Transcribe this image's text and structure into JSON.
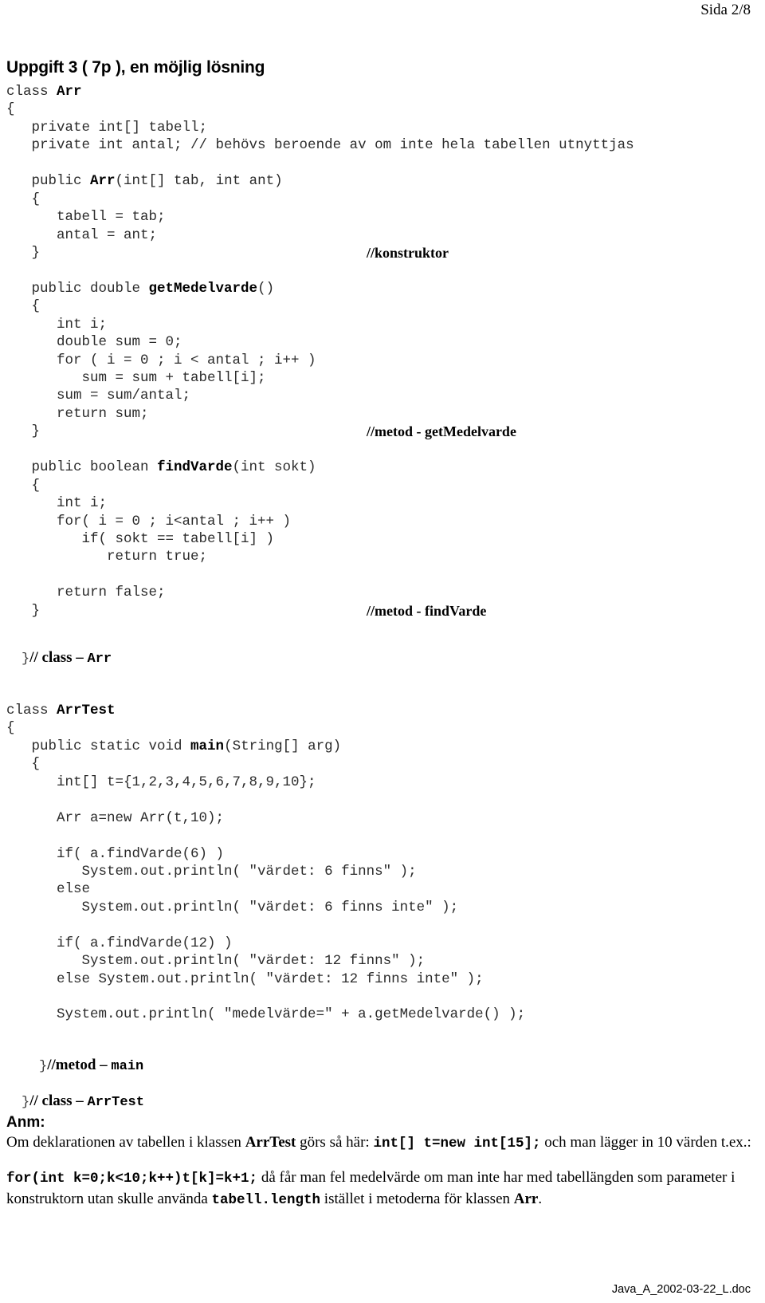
{
  "header": {
    "page_indicator": "Sida 2/8"
  },
  "title": "Uppgift 3 ( 7p ), en möjlig lösning",
  "code": {
    "lines": [
      {
        "text": "class ",
        "bold": "Arr",
        "after": ""
      },
      {
        "text": "{"
      },
      {
        "text": "   private int[] tabell;"
      },
      {
        "text": "   private int antal; // behövs beroende av om inte hela tabellen utnyttjas"
      },
      {
        "text": ""
      },
      {
        "text": "   public ",
        "bold": "Arr",
        "after": "(int[] tab, int ant)"
      },
      {
        "text": "   {"
      },
      {
        "text": "      tabell = tab;"
      },
      {
        "text": "      antal = ant;"
      },
      {
        "text": "   }",
        "annot": "//konstruktor"
      },
      {
        "text": ""
      },
      {
        "text": "   public double ",
        "bold": "getMedelvarde",
        "after": "()"
      },
      {
        "text": "   {"
      },
      {
        "text": "      int i;"
      },
      {
        "text": "      double sum = 0;"
      },
      {
        "text": "      for ( i = 0 ; i < antal ; i++ )"
      },
      {
        "text": "         sum = sum + tabell[i];"
      },
      {
        "text": "      sum = sum/antal;"
      },
      {
        "text": "      return sum;"
      },
      {
        "text": "   }",
        "annot": "//metod - getMedelvarde"
      },
      {
        "text": ""
      },
      {
        "text": "   public boolean ",
        "bold": "findVarde",
        "after": "(int sokt)"
      },
      {
        "text": "   {"
      },
      {
        "text": "      int i;"
      },
      {
        "text": "      for( i = 0 ; i<antal ; i++ )"
      },
      {
        "text": "         if( sokt == tabell[i] )"
      },
      {
        "text": "            return true;"
      },
      {
        "text": ""
      },
      {
        "text": "      return false;"
      },
      {
        "text": "   }",
        "annot": "//metod - findVarde"
      }
    ]
  },
  "close_arr": {
    "brace": "}",
    "comment": "// class – ",
    "name": "Arr"
  },
  "code2": {
    "lines": [
      {
        "text": "class ",
        "bold": "ArrTest",
        "after": ""
      },
      {
        "text": "{"
      },
      {
        "text": "   public static void ",
        "bold": "main",
        "after": "(String[] arg)"
      },
      {
        "text": "   {"
      },
      {
        "text": "      int[] t={1,2,3,4,5,6,7,8,9,10};"
      },
      {
        "text": ""
      },
      {
        "text": "      Arr a=new Arr(t,10);"
      },
      {
        "text": ""
      },
      {
        "text": "      if( a.findVarde(6) )"
      },
      {
        "text": "         System.out.println( \"värdet: 6 finns\" );"
      },
      {
        "text": "      else"
      },
      {
        "text": "         System.out.println( \"värdet: 6 finns inte\" );"
      },
      {
        "text": ""
      },
      {
        "text": "      if( a.findVarde(12) )"
      },
      {
        "text": "         System.out.println( \"värdet: 12 finns\" );"
      },
      {
        "text": "      else System.out.println( \"värdet: 12 finns inte\" );"
      },
      {
        "text": ""
      },
      {
        "text": "      System.out.println( \"medelvärde=\" + a.getMedelvarde() );"
      }
    ]
  },
  "close_main": {
    "brace": "}",
    "comment": "//metod – ",
    "name": "main"
  },
  "close_arrtest": {
    "brace": "}",
    "comment": "// class – ",
    "name": "ArrTest"
  },
  "note": {
    "label": "Anm:",
    "line1_a": "Om deklarationen av tabellen i klassen ",
    "line1_b": "ArrTest",
    "line1_c": " görs så här: ",
    "line1_d": "int[] t=new int[15];",
    "line1_e": " och man lägger in 10 värden t.ex.:",
    "line2_a": "for(int k=0;k<10;k++)t[k]=k+1;",
    "line2_b": " då får man fel medelvärde om man inte har med tabellängden som parameter i  konstruktorn utan skulle använda ",
    "line2_c": "tabell.length",
    "line2_d": " istället i metoderna för klassen ",
    "line2_e": "Arr",
    "line2_f": "."
  },
  "footer": {
    "filename": "Java_A_2002-03-22_L.doc"
  }
}
